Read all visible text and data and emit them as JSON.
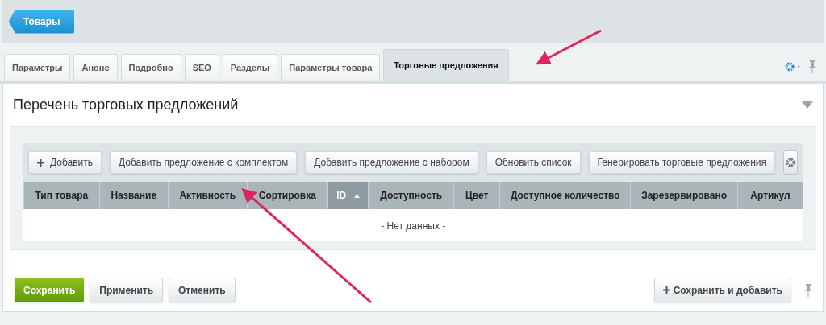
{
  "breadcrumb": {
    "label": "Товары"
  },
  "tabs": [
    {
      "label": "Параметры",
      "selected": false
    },
    {
      "label": "Анонс",
      "selected": false
    },
    {
      "label": "Подробно",
      "selected": false
    },
    {
      "label": "SEO",
      "selected": false
    },
    {
      "label": "Разделы",
      "selected": false
    },
    {
      "label": "Параметры товара",
      "selected": false
    },
    {
      "label": "Торговые предложения",
      "selected": true
    }
  ],
  "section": {
    "title": "Перечень торговых предложений",
    "expanded": true
  },
  "toolbar": [
    {
      "label": "Добавить",
      "kind": "add"
    },
    {
      "label": "Добавить предложение с комплектом",
      "kind": "plain"
    },
    {
      "label": "Добавить предложение с набором",
      "kind": "plain"
    },
    {
      "label": "Обновить список",
      "kind": "plain"
    },
    {
      "label": "Генерировать торговые предложения",
      "kind": "plain"
    }
  ],
  "table": {
    "columns": [
      {
        "label": "Тип товара",
        "sorted": false
      },
      {
        "label": "Название",
        "sorted": false
      },
      {
        "label": "Активность",
        "sorted": false
      },
      {
        "label": "Сортировка",
        "sorted": false
      },
      {
        "label": "ID",
        "sorted": true
      },
      {
        "label": "Доступность",
        "sorted": false
      },
      {
        "label": "Цвет",
        "sorted": false
      },
      {
        "label": "Доступное количество",
        "sorted": false
      },
      {
        "label": "Зарезервировано",
        "sorted": false
      },
      {
        "label": "Артикул",
        "sorted": false
      }
    ],
    "empty_text": "- Нет данных -"
  },
  "footer": {
    "buttons": [
      {
        "label": "Сохранить",
        "kind": "primary"
      },
      {
        "label": "Применить",
        "kind": "plain"
      },
      {
        "label": "Отменить",
        "kind": "plain"
      }
    ],
    "save_and_add": "Сохранить и добавить"
  }
}
